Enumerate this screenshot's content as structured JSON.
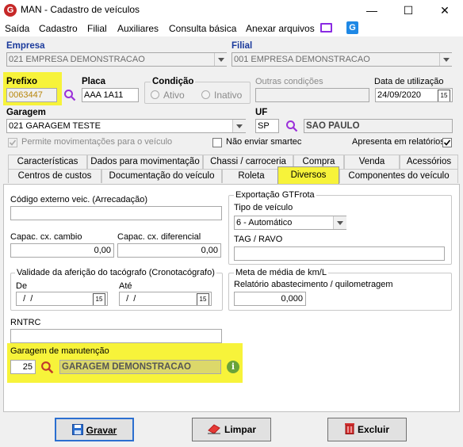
{
  "window": {
    "title": "MAN - Cadastro de veículos",
    "minimize": "—",
    "maximize": "☐",
    "close": "✕"
  },
  "menu": [
    "Saída",
    "Cadastro",
    "Filial",
    "Auxiliares",
    "Consulta básica",
    "Anexar arquivos"
  ],
  "empresa": {
    "label": "Empresa",
    "value": "021 EMPRESA DEMONSTRACAO"
  },
  "filial": {
    "label": "Filial",
    "value": "001 EMPRESA DEMONSTRACAO"
  },
  "prefixo": {
    "label": "Prefixo",
    "value": "0063447"
  },
  "placa": {
    "label": "Placa",
    "value": "AAA 1A11"
  },
  "condicao": {
    "label": "Condição",
    "ativo": "Ativo",
    "inativo": "Inativo"
  },
  "outras_condicoes": {
    "label": "Outras condições",
    "value": ""
  },
  "data_utilizacao": {
    "label": "Data de utilização",
    "value": "24/09/2020"
  },
  "garagem": {
    "label": "Garagem",
    "value": "021 GARAGEM TESTE"
  },
  "uf": {
    "label": "UF",
    "code": "SP",
    "name": "SAO PAULO"
  },
  "checks": {
    "permite": "Permite movimentações para o veículo",
    "nao_enviar": "Não enviar smartec",
    "apresenta": "Apresenta em relatórios"
  },
  "tabs_row1": [
    "Características",
    "Dados para movimentação",
    "Chassi / carroceria",
    "Compra",
    "Venda",
    "Acessórios"
  ],
  "tabs_row2": [
    "Centros de custos",
    "Documentação do veículo",
    "Roleta",
    "Diversos",
    "Componentes do veículo"
  ],
  "diversos": {
    "codigo_externo": {
      "label": "Código externo veic. (Arrecadação)",
      "value": ""
    },
    "capac_cambio": {
      "label": "Capac. cx. cambio",
      "value": "0,00"
    },
    "capac_diferencial": {
      "label": "Capac. cx. diferencial",
      "value": "0,00"
    },
    "validade": {
      "title": "Validade da aferição do tacógrafo (Cronotacógrafo)",
      "de_label": "De",
      "de_value": "  /  /",
      "ate_label": "Até",
      "ate_value": "  /  /"
    },
    "rntrc": {
      "label": "RNTRC",
      "value": ""
    },
    "garagem_manut": {
      "label": "Garagem de manutenção",
      "code": "25",
      "name": "GARAGEM DEMONSTRACAO"
    },
    "exportacao": {
      "title": "Exportação GTFrota",
      "tipo_label": "Tipo de veículo",
      "tipo_value": "6 - Automático",
      "tag_label": "TAG / RAVO",
      "tag_value": ""
    },
    "meta": {
      "title": "Meta de média de km/L",
      "label": "Relatório abastecimento / quilometragem",
      "value": "0,000"
    }
  },
  "buttons": {
    "gravar": "Gravar",
    "limpar": "Limpar",
    "excluir": "Excluir"
  },
  "calendar_icon_text": "15"
}
